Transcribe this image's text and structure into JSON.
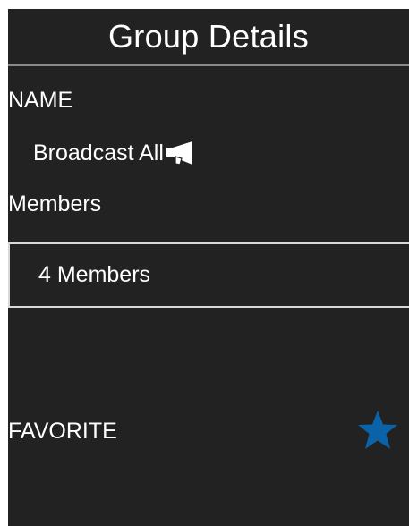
{
  "header": {
    "title": "Group Details"
  },
  "name_section": {
    "label": "NAME",
    "value": "Broadcast All",
    "icon": "megaphone-icon"
  },
  "members_section": {
    "label": "Members",
    "value": "4 Members"
  },
  "favorite_section": {
    "label": "FAVORITE",
    "icon": "star-icon",
    "favorited": true,
    "star_color": "#0a62a8"
  },
  "colors": {
    "background": "#222222",
    "text": "#ffffff",
    "divider": "#8a8a8a",
    "box_border": "#d8d8d8"
  }
}
